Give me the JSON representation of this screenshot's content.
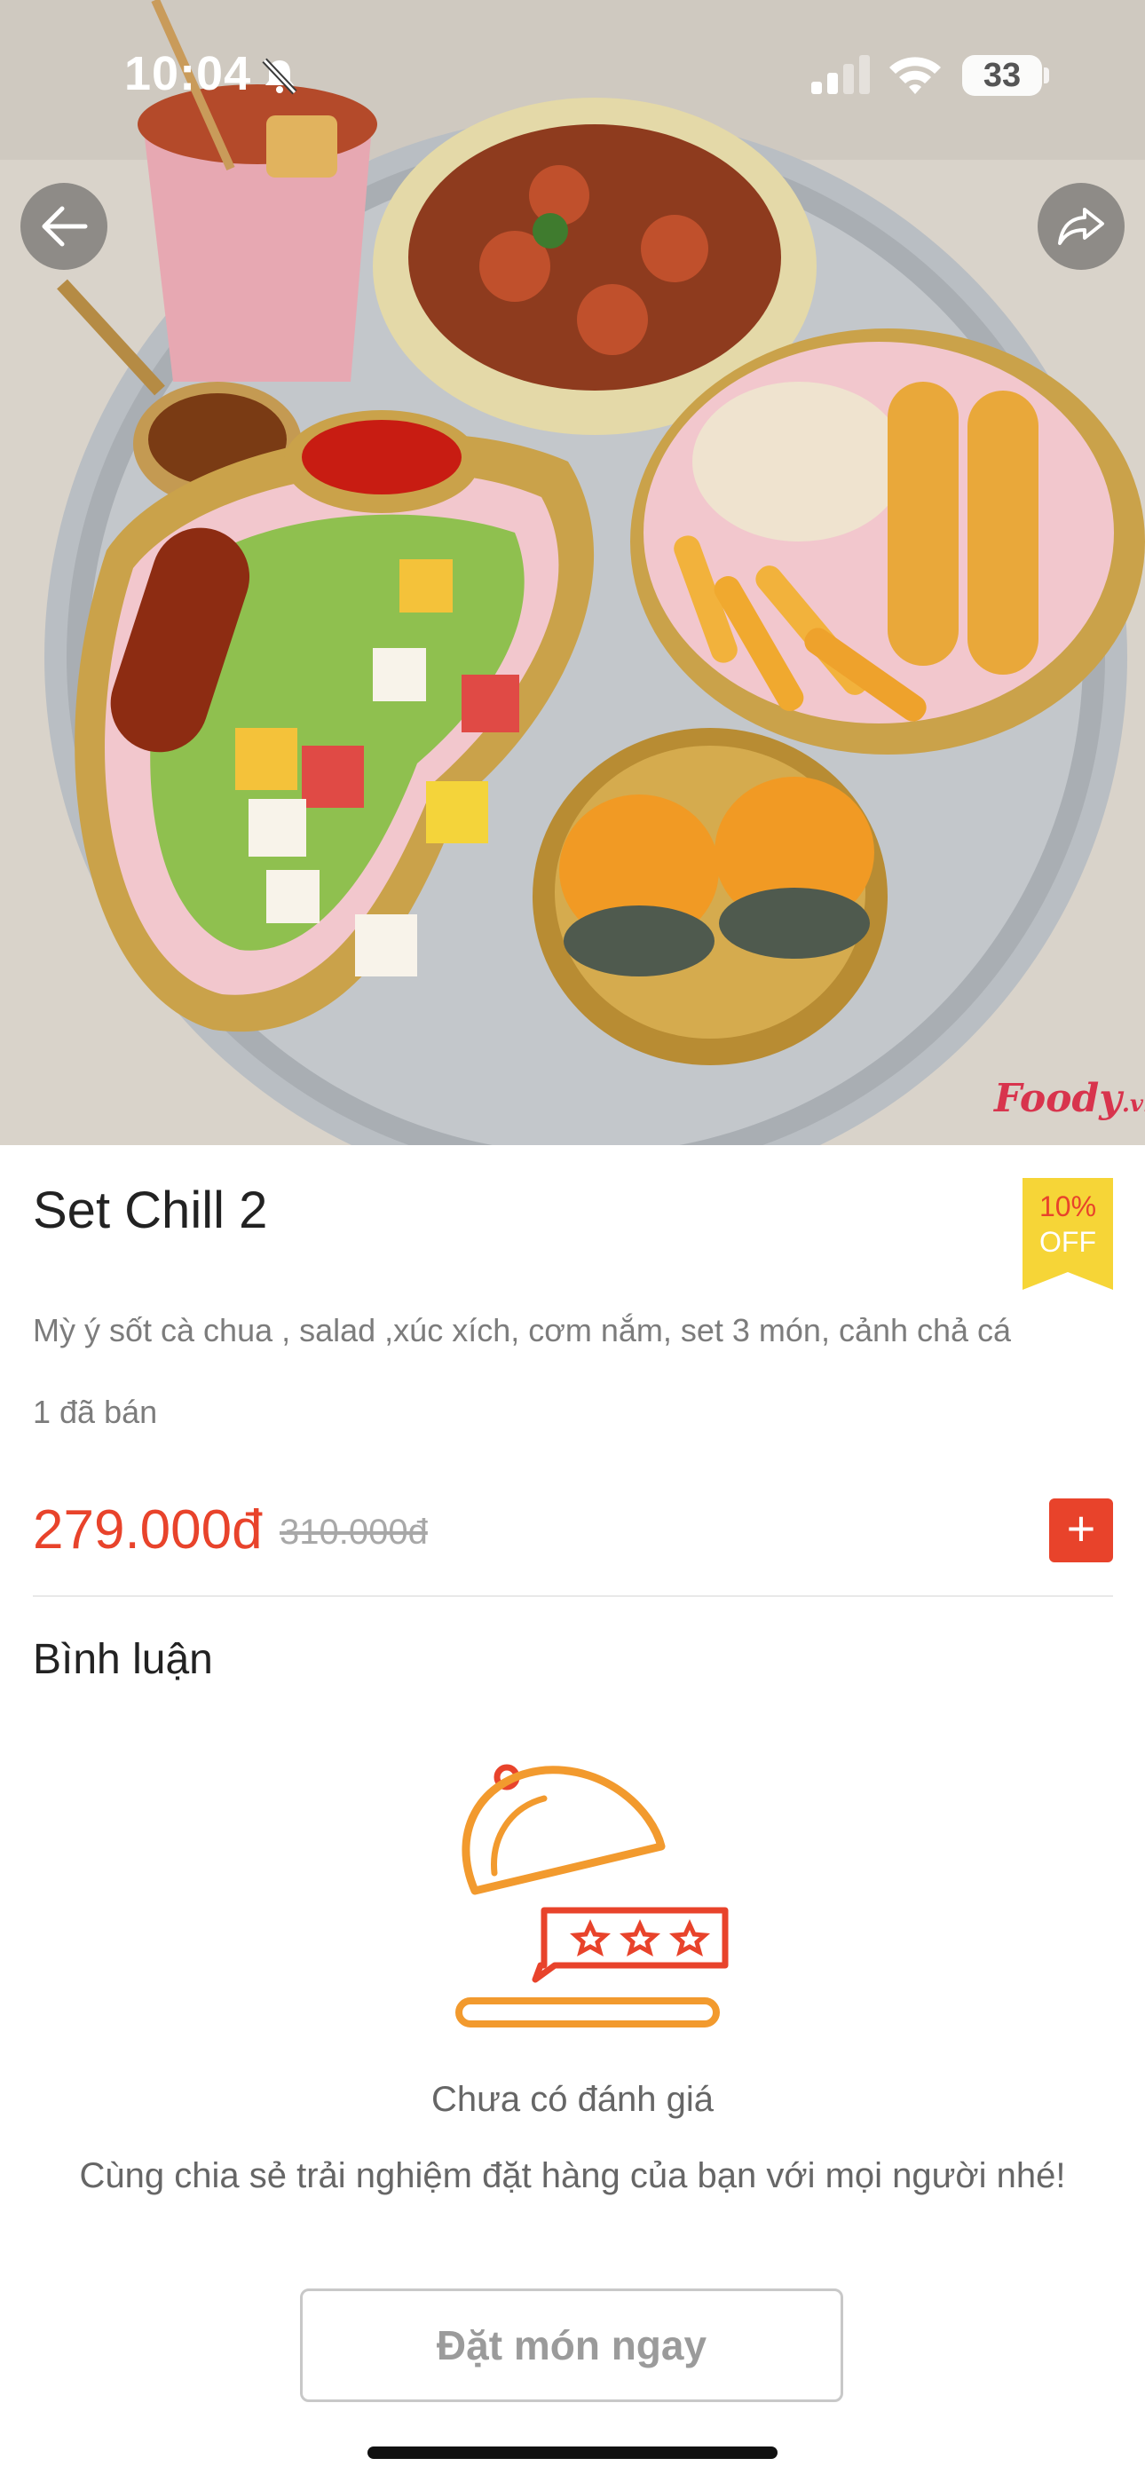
{
  "status_bar": {
    "time": "10:04",
    "battery": "33",
    "icons": [
      "bell-slash-icon",
      "cellular-signal-icon",
      "wifi-icon",
      "battery-icon"
    ]
  },
  "hero": {
    "watermark": "Foody",
    "watermark_suffix": ".vn",
    "back_icon": "arrow-left-icon",
    "share_icon": "share-icon"
  },
  "product": {
    "name": "Set Chill 2",
    "discount_percent": "10%",
    "discount_label": "OFF",
    "description": "Mỳ ý sốt cà chua , salad ,xúc xích, cơm nắm, set 3 món, cảnh chả cá",
    "sold": "1 đã bán",
    "price": "279.000đ",
    "original_price": "310.000đ",
    "add_label": "+"
  },
  "reviews": {
    "section_title": "Bình luận",
    "empty_title": "Chưa có đánh giá",
    "empty_message": "Cùng chia sẻ trải nghiệm đặt hàng của bạn với mọi người nhé!",
    "order_button": "Đặt món ngay"
  },
  "colors": {
    "accent": "#e8432b",
    "badge": "#f6d537",
    "illustration": "#f29a2e"
  }
}
